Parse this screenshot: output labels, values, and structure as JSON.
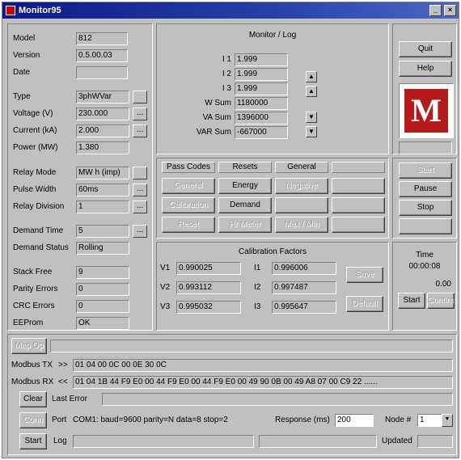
{
  "window": {
    "title": "Monitor95"
  },
  "device": {
    "model_label": "Model",
    "model": "812",
    "version_label": "Version",
    "version": "0.5.00.03",
    "date_label": "Date",
    "date": "",
    "type_label": "Type",
    "type": "3phWVar",
    "voltage_label": "Voltage (V)",
    "voltage": "230.000",
    "current_label": "Current (kA)",
    "current": "2.000",
    "power_label": "Power (MW)",
    "power": "1.380",
    "relay_mode_label": "Relay Mode",
    "relay_mode": "MW h (imp)",
    "pulse_width_label": "Pulse Width",
    "pulse_width": "60ms",
    "relay_division_label": "Relay Division",
    "relay_division": "1",
    "demand_time_label": "Demand Time",
    "demand_time": "5",
    "demand_status_label": "Demand Status",
    "demand_status": "Rolling",
    "stack_free_label": "Stack Free",
    "stack_free": "9",
    "parity_errors_label": "Parity Errors",
    "parity_errors": "0",
    "crc_errors_label": "CRC Errors",
    "crc_errors": "0",
    "eeprom_label": "EEProm",
    "eeprom": "OK",
    "ellipsis": "..."
  },
  "monitor": {
    "title": "Monitor / Log",
    "rows": [
      {
        "label": "I 1",
        "value": "1.999"
      },
      {
        "label": "I 2",
        "value": "1.999"
      },
      {
        "label": "I 3",
        "value": "1.999"
      },
      {
        "label": "W Sum",
        "value": "1180000"
      },
      {
        "label": "VA Sum",
        "value": "1396000"
      },
      {
        "label": "VAR Sum",
        "value": "-667000"
      }
    ],
    "up": "▲",
    "down": "▼"
  },
  "buttons": {
    "quit": "Quit",
    "help": "Help",
    "start": "Start",
    "pause": "Pause",
    "stop": "Stop"
  },
  "grid": {
    "headers": [
      "Pass Codes",
      "Resets",
      "General",
      ""
    ],
    "cells": [
      [
        "General",
        "Energy",
        "Negative",
        ""
      ],
      [
        "Calibration",
        "Demand",
        "",
        ""
      ],
      [
        "Reset",
        "Hr Meter",
        "Max / Min",
        ""
      ]
    ],
    "enabled": [
      [
        false,
        true,
        false,
        true
      ],
      [
        false,
        true,
        true,
        true
      ],
      [
        false,
        false,
        false,
        true
      ]
    ]
  },
  "calibration": {
    "title": "Calibration Factors",
    "rows": [
      {
        "v_label": "V1",
        "v": "0.990025",
        "i_label": "I1",
        "i": "0.996006"
      },
      {
        "v_label": "V2",
        "v": "0.993112",
        "i_label": "I2",
        "i": "0.997487"
      },
      {
        "v_label": "V3",
        "v": "0.995032",
        "i_label": "I3",
        "i": "0.995647"
      }
    ],
    "btn1": "Save",
    "btn2": "Default"
  },
  "timer": {
    "title": "Time",
    "time": "00:00:08",
    "count": "0.00",
    "start": "Start",
    "continue": "Continue"
  },
  "bottom": {
    "map_btn": "Map Op",
    "tx_label": "Modbus TX",
    "tx_dir": ">>",
    "tx": "01 04 00 0C 00 0E 30 0C",
    "rx_label": "Modbus RX",
    "rx_dir": "<<",
    "rx": "01 04 1B 44 F9 E0 00 44 F9 E0 00 44 F9 E0 00 49 90 0B 00 49 A8 07 00 C9 22 ......",
    "clear": "Clear",
    "last_error_label": "Last Error",
    "last_error": "",
    "conn_btn": "Conn",
    "port_label": "Port",
    "port": "COM1: baud=9600 parity=N data=8 stop=2",
    "response_label": "Response (ms)",
    "response": "200",
    "node_label": "Node #",
    "node": "1",
    "start": "Start",
    "log_label": "Log",
    "log": "",
    "updated_label": "Updated",
    "updated": ""
  }
}
